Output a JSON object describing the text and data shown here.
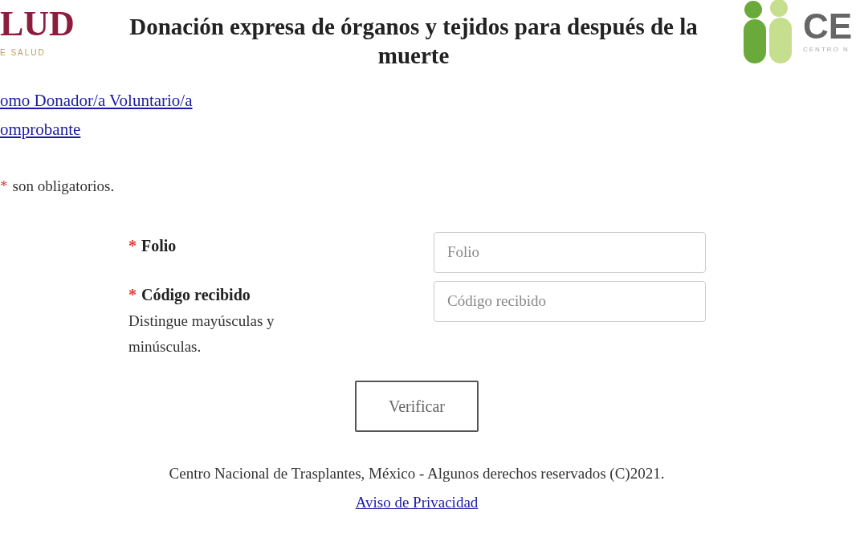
{
  "header": {
    "left_logo": {
      "text": "LUD",
      "subtext": "E SALUD"
    },
    "title": "Donación expresa de órganos y tejidos para después de la muerte",
    "right_logo": {
      "text": "CE",
      "subtext": "CENTRO N"
    }
  },
  "links": [
    "omo Donador/a Voluntario/a",
    "omprobante"
  ],
  "required_note": {
    "mark": "*",
    "text": "son obligatorios."
  },
  "fields": [
    {
      "required_mark": "*",
      "label": "Folio",
      "placeholder": "Folio"
    },
    {
      "required_mark": "*",
      "label": "Código recibido",
      "hint": "Distingue mayúsculas y minúsculas.",
      "placeholder": "Código recibido"
    }
  ],
  "submit": "Verificar",
  "footer": {
    "text": "Centro Nacional de Trasplantes, México - Algunos derechos reservados (C)2021.",
    "link": "Aviso de Privacidad"
  }
}
